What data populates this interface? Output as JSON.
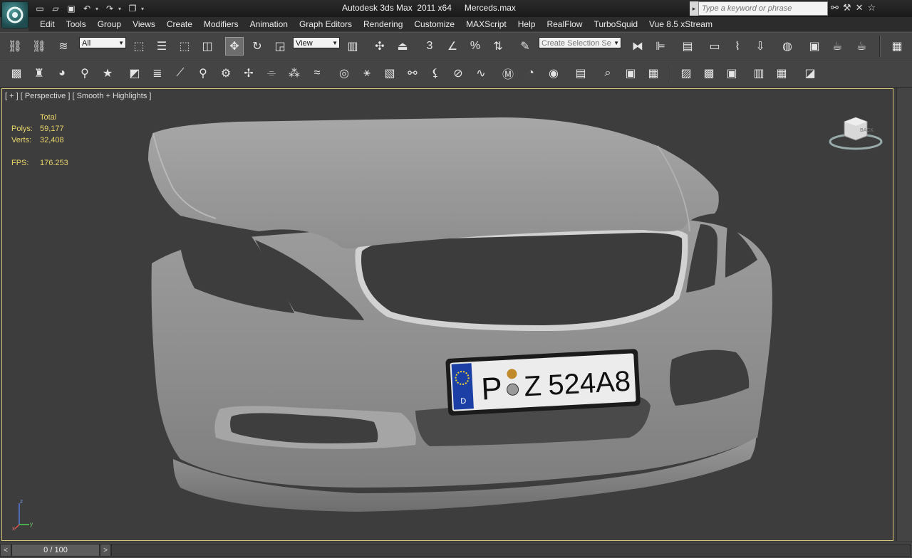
{
  "titlebar": {
    "app_title": "Autodesk 3ds Max  2011 x64",
    "document": "Merceds.max",
    "search_placeholder": "Type a keyword or phrase",
    "quick_access": [
      "new-file-icon",
      "open-file-icon",
      "save-icon",
      "undo-icon",
      "redo-icon",
      "project-folder-icon"
    ],
    "info_icons": [
      "binoculars-icon",
      "tools-icon",
      "exchange-icon",
      "favorite-star-icon"
    ]
  },
  "menubar": {
    "items": [
      "Edit",
      "Tools",
      "Group",
      "Views",
      "Create",
      "Modifiers",
      "Animation",
      "Graph Editors",
      "Rendering",
      "Customize",
      "MAXScript",
      "Help",
      "RealFlow",
      "TurboSquid",
      "Vue 8.5 xStream"
    ]
  },
  "main_toolbar": {
    "selection_filter": "All",
    "reference_coord": "View",
    "named_selection": "Create Selection Se",
    "snap_angle_label": "3"
  },
  "viewport": {
    "label": "[ + ] [ Perspective ] [ Smooth + Highlights ]",
    "stats": {
      "header": "Total",
      "polys_label": "Polys:",
      "polys_value": "59,177",
      "verts_label": "Verts:",
      "verts_value": "32,408",
      "fps_label": "FPS:",
      "fps_value": "176.253"
    },
    "viewcube_face": "BACK",
    "plate": {
      "country": "D",
      "chars": [
        "P",
        "Z",
        "524A8"
      ]
    },
    "axis": {
      "x": "x",
      "y": "y",
      "z": "z"
    }
  },
  "timeline": {
    "position": "0 / 100",
    "prev": "<",
    "next": ">"
  },
  "colors": {
    "viewport_border": "#d6c97a",
    "stats_text": "#e8d46a",
    "active_tool": "#6d6d6d"
  }
}
